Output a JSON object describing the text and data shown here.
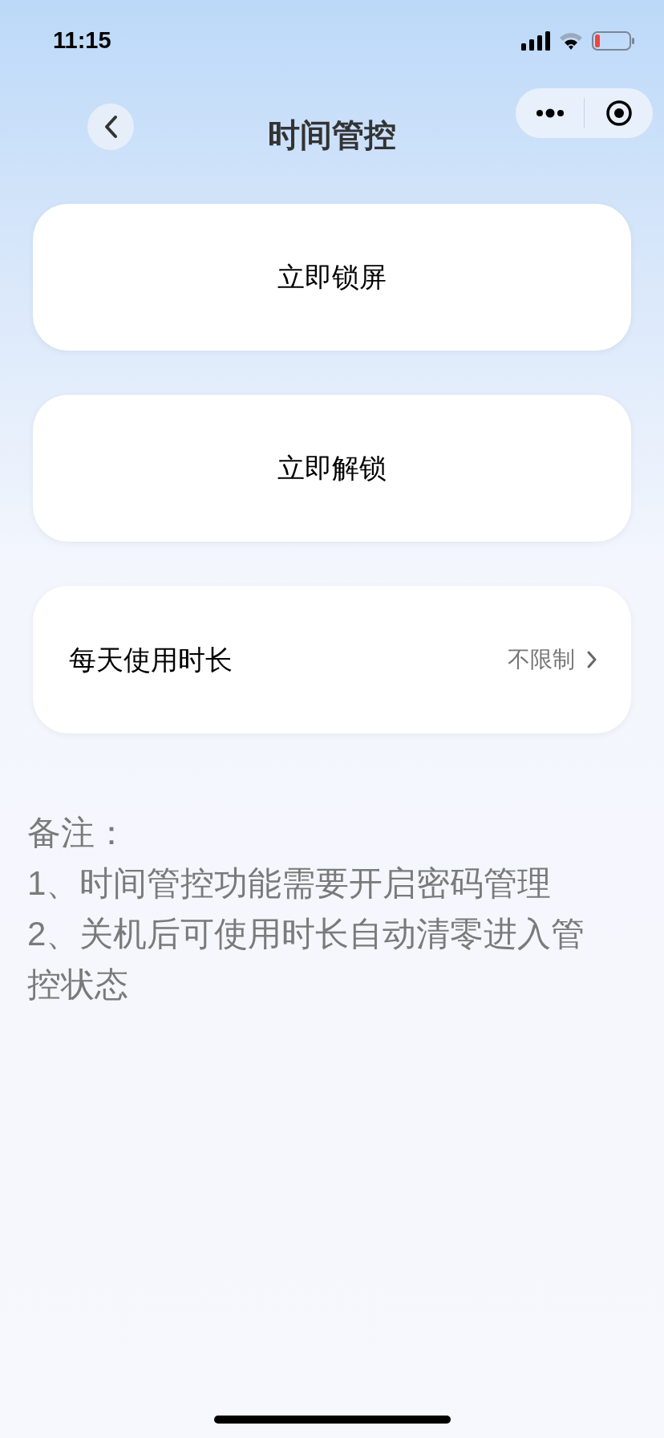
{
  "status_bar": {
    "time": "11:15",
    "battery_low": true
  },
  "nav": {
    "title": "时间管控"
  },
  "actions": [
    {
      "label": "立即锁屏"
    },
    {
      "label": "立即解锁"
    }
  ],
  "setting": {
    "label": "每天使用时长",
    "value": "不限制"
  },
  "notes": [
    "备注：",
    "1、时间管控功能需要开启密码管理",
    "2、关机后可使用时长自动清零进入管控状态"
  ]
}
